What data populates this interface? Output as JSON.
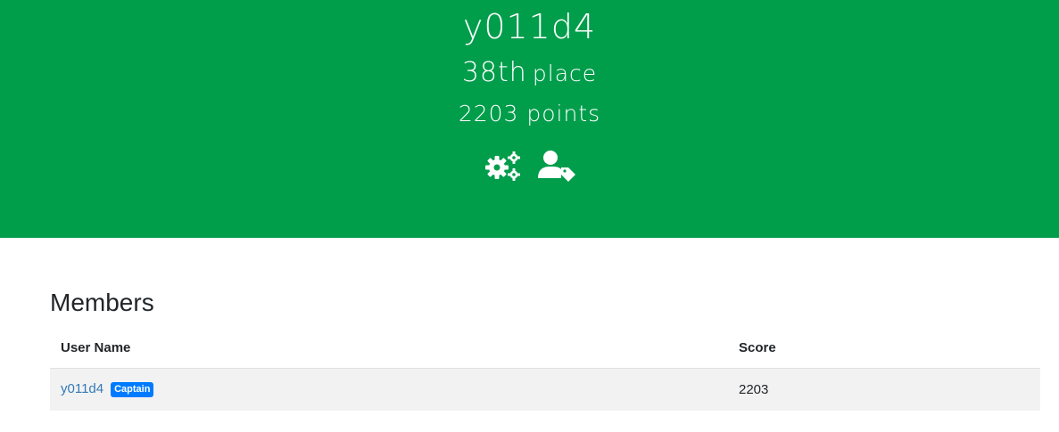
{
  "team": {
    "name": "y011d4",
    "place_number": "38th",
    "place_word": "place",
    "points_text": "2203 points"
  },
  "header_icons": [
    {
      "icon": "gears-icon"
    },
    {
      "icon": "user-tag-icon"
    }
  ],
  "colors": {
    "header_bg": "#009d4b",
    "link": "#337ab7",
    "badge": "#007bff"
  },
  "members": {
    "title": "Members",
    "columns": [
      "User Name",
      "Score"
    ],
    "rows": [
      {
        "user_name": "y011d4",
        "badge": "Captain",
        "score": "2203"
      }
    ]
  }
}
